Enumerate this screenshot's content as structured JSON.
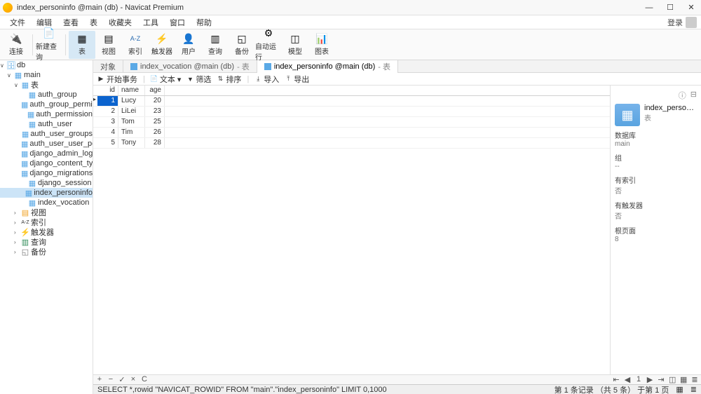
{
  "window": {
    "title": "index_personinfo @main (db) - Navicat Premium"
  },
  "menubar": {
    "items": [
      "文件",
      "编辑",
      "查看",
      "表",
      "收藏夹",
      "工具",
      "窗口",
      "帮助"
    ],
    "login_label": "登录"
  },
  "toolbar": {
    "items": [
      {
        "label": "连接",
        "icon": "🔌",
        "sep_after": true
      },
      {
        "label": "新建查询",
        "icon": "📄",
        "sep_after": true
      },
      {
        "label": "表",
        "icon": "▦",
        "active": true
      },
      {
        "label": "视图",
        "icon": "▤"
      },
      {
        "label": "索引",
        "icon": "A-Z",
        "text_icon": true
      },
      {
        "label": "触发器",
        "icon": "⚡"
      },
      {
        "label": "用户",
        "icon": "👤"
      },
      {
        "label": "查询",
        "icon": "▥"
      },
      {
        "label": "备份",
        "icon": "◱"
      },
      {
        "label": "自动运行",
        "icon": "⚙"
      },
      {
        "label": "模型",
        "icon": "◫"
      },
      {
        "label": "图表",
        "icon": "📊"
      }
    ]
  },
  "sidebar": {
    "nodes": [
      {
        "level": 0,
        "caret": "∨",
        "icon": "🗄",
        "label": "db",
        "icon_class": "ico-db"
      },
      {
        "level": 1,
        "caret": "∨",
        "icon": "▦",
        "label": "main",
        "icon_class": "ico-table"
      },
      {
        "level": 2,
        "caret": "∨",
        "icon": "▦",
        "label": "表",
        "icon_class": "ico-table"
      },
      {
        "level": 3,
        "caret": "",
        "icon": "▦",
        "label": "auth_group",
        "icon_class": "ico-table"
      },
      {
        "level": 3,
        "caret": "",
        "icon": "▦",
        "label": "auth_group_permissi",
        "icon_class": "ico-table"
      },
      {
        "level": 3,
        "caret": "",
        "icon": "▦",
        "label": "auth_permission",
        "icon_class": "ico-table"
      },
      {
        "level": 3,
        "caret": "",
        "icon": "▦",
        "label": "auth_user",
        "icon_class": "ico-table"
      },
      {
        "level": 3,
        "caret": "",
        "icon": "▦",
        "label": "auth_user_groups",
        "icon_class": "ico-table"
      },
      {
        "level": 3,
        "caret": "",
        "icon": "▦",
        "label": "auth_user_user_perm",
        "icon_class": "ico-table"
      },
      {
        "level": 3,
        "caret": "",
        "icon": "▦",
        "label": "django_admin_log",
        "icon_class": "ico-table"
      },
      {
        "level": 3,
        "caret": "",
        "icon": "▦",
        "label": "django_content_type",
        "icon_class": "ico-table"
      },
      {
        "level": 3,
        "caret": "",
        "icon": "▦",
        "label": "django_migrations",
        "icon_class": "ico-table"
      },
      {
        "level": 3,
        "caret": "",
        "icon": "▦",
        "label": "django_session",
        "icon_class": "ico-table"
      },
      {
        "level": 3,
        "caret": "",
        "icon": "▦",
        "label": "index_personinfo",
        "icon_class": "ico-table",
        "selected": true
      },
      {
        "level": 3,
        "caret": "",
        "icon": "▦",
        "label": "index_vocation",
        "icon_class": "ico-table"
      },
      {
        "level": 2,
        "caret": "›",
        "icon": "▤",
        "label": "视图",
        "icon_class": "ico-view"
      },
      {
        "level": 2,
        "caret": "›",
        "icon": "A-Z",
        "label": "索引",
        "icon_class": "",
        "text_icon": true
      },
      {
        "level": 2,
        "caret": "›",
        "icon": "⚡",
        "label": "触发器",
        "icon_class": ""
      },
      {
        "level": 2,
        "caret": "›",
        "icon": "▥",
        "label": "查询",
        "icon_class": "ico-query"
      },
      {
        "level": 2,
        "caret": "›",
        "icon": "◱",
        "label": "备份",
        "icon_class": "ico-backup"
      }
    ]
  },
  "tabs": [
    {
      "label": "对象",
      "active": false,
      "suffix": ""
    },
    {
      "label": "index_vocation @main (db)",
      "suffix": "- 表",
      "active": false
    },
    {
      "label": "index_personinfo @main (db)",
      "suffix": "- 表",
      "active": true
    }
  ],
  "subtoolbar": {
    "items": [
      {
        "icon": "▶",
        "label": "开始事务"
      },
      {
        "icon": "📄",
        "label": "文本 ▾"
      },
      {
        "icon": "▼",
        "label": "筛选"
      },
      {
        "icon": "⇅",
        "label": "排序"
      },
      {
        "icon": "⤓",
        "label": "导入"
      },
      {
        "icon": "⤒",
        "label": "导出"
      }
    ]
  },
  "grid": {
    "columns": [
      "id",
      "name",
      "age"
    ],
    "rows": [
      {
        "id": "1",
        "name": "Lucy",
        "age": "20",
        "current": true
      },
      {
        "id": "2",
        "name": "LiLei",
        "age": "23"
      },
      {
        "id": "3",
        "name": "Tom",
        "age": "25"
      },
      {
        "id": "4",
        "name": "Tim",
        "age": "26"
      },
      {
        "id": "5",
        "name": "Tony",
        "age": "28"
      }
    ]
  },
  "right_panel": {
    "object_name": "index_personin...",
    "object_type": "表",
    "kv": [
      {
        "k": "数据库",
        "v": "main"
      },
      {
        "k": "组",
        "v": "--"
      },
      {
        "k": "有索引",
        "v": "否"
      },
      {
        "k": "有触发器",
        "v": "否"
      },
      {
        "k": "根页面",
        "v": "8"
      }
    ]
  },
  "bottom_toolbar": {
    "left": [
      "+",
      "−",
      "✓",
      "×",
      "C"
    ],
    "right": [
      "⇤",
      "◀",
      "1",
      "▶",
      "⇥",
      "◫",
      "▦",
      "≣"
    ]
  },
  "statusbar": {
    "sql": "SELECT *,rowid \"NAVICAT_ROWID\" FROM \"main\".\"index_personinfo\" LIMIT 0,1000",
    "record_info": "第 1 条记录 （共 5 条） 于第 1 页"
  }
}
